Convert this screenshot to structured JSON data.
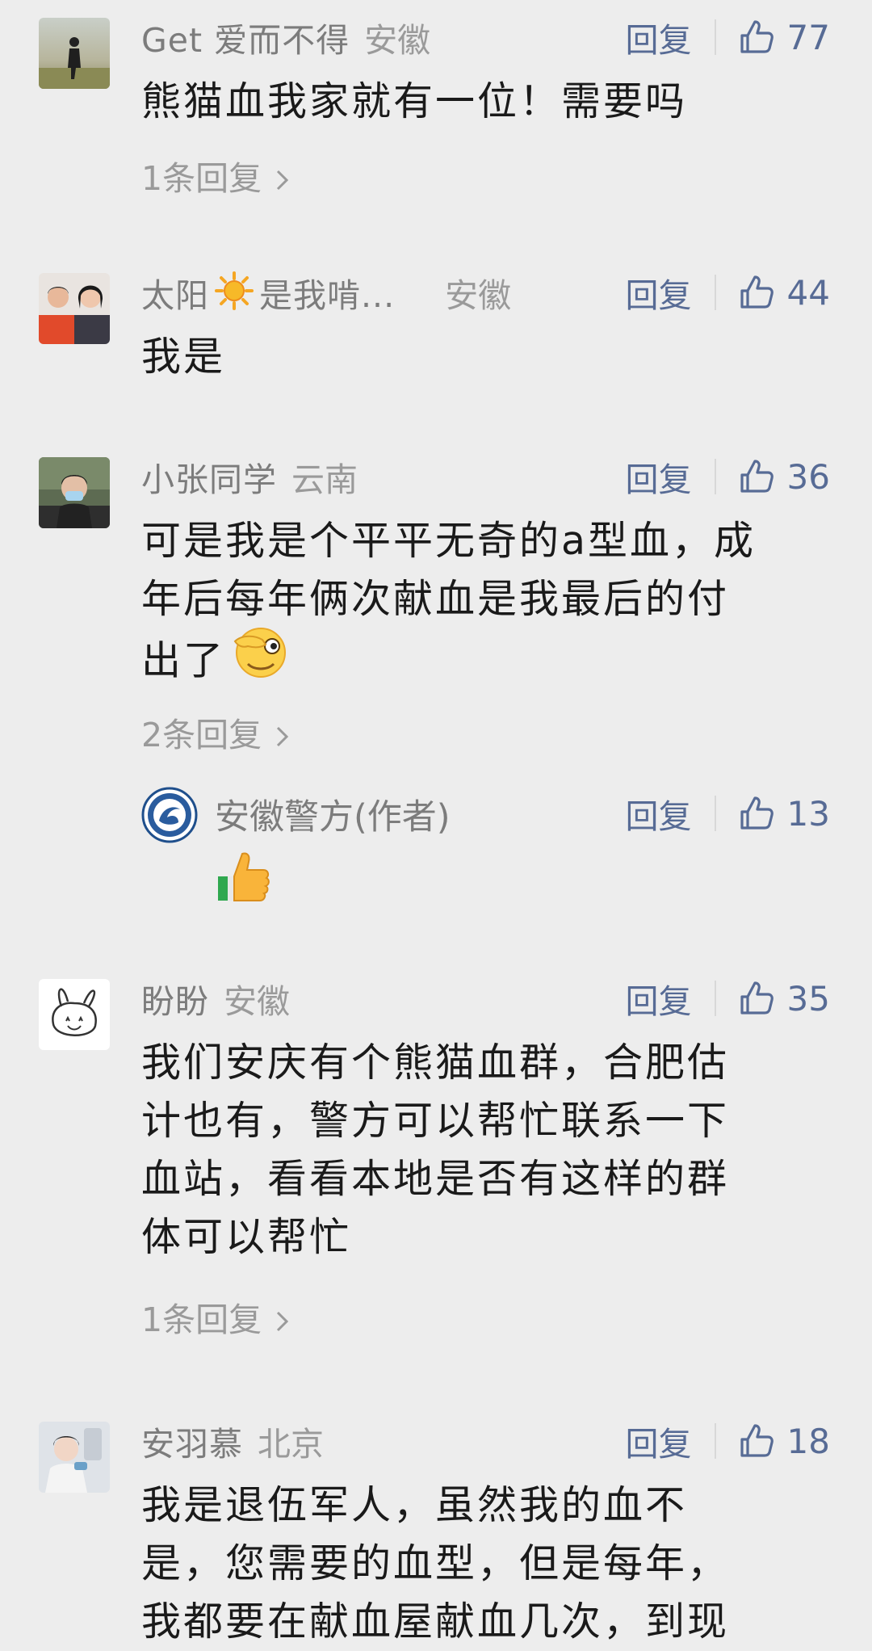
{
  "comments": [
    {
      "nickname": "Get 爱而不得",
      "location": "安徽",
      "reply_label": "回复",
      "likes": "77",
      "lines": [
        "熊猫血我家就有一位！需要吗"
      ],
      "replies_link": "1条回复"
    },
    {
      "nickname": "太阳",
      "nickname_suffix": "是我啃...",
      "location": "安徽",
      "reply_label": "回复",
      "likes": "44",
      "lines": [
        "我是"
      ]
    },
    {
      "nickname": "小张同学",
      "location": "云南",
      "reply_label": "回复",
      "likes": "36",
      "lines": [
        "可是我是个平平无奇的a型血，成",
        "年后每年俩次献血是我最后的付",
        "出了"
      ],
      "replies_link": "2条回复",
      "author_reply": {
        "nickname": "安徽警方(作者)",
        "reply_label": "回复",
        "likes": "13"
      }
    },
    {
      "nickname": "盼盼",
      "location": "安徽",
      "reply_label": "回复",
      "likes": "35",
      "lines": [
        "我们安庆有个熊猫血群，合肥估",
        "计也有，警方可以帮忙联系一下",
        "血站，看看本地是否有这样的群",
        "体可以帮忙"
      ],
      "replies_link": "1条回复"
    },
    {
      "nickname": "安羽慕",
      "location": "北京",
      "reply_label": "回复",
      "likes": "18",
      "lines": [
        "我是退伍军人，虽然我的血不",
        "是，您需要的血型，但是每年，",
        "我都要在献血屋献血几次，到现"
      ]
    }
  ],
  "icons": {
    "like": "thumbs-up-outline-icon",
    "chevron": "chevron-right-icon",
    "sun_emoji": "sun-emoji",
    "wink_emoji": "wink-hand-emoji",
    "thumbsup_emoji": "thumbs-up-emoji"
  },
  "colors": {
    "background": "#ededed",
    "link_blue": "#576b95",
    "text": "#1a1a1a",
    "meta_gray": "#7c7c7c"
  }
}
